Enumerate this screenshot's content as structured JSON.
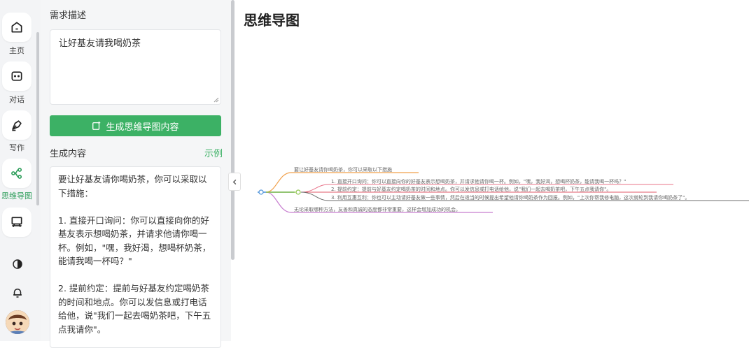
{
  "nav": {
    "items": [
      {
        "label": "主页",
        "icon": "home-icon"
      },
      {
        "label": "对话",
        "icon": "chat-icon"
      },
      {
        "label": "写作",
        "icon": "pen-icon"
      },
      {
        "label": "思维导图",
        "icon": "mindmap-icon",
        "active": true
      },
      {
        "label": "",
        "icon": "presentation-icon"
      }
    ],
    "bottom_icons": [
      "theme-contrast-icon",
      "bell-icon"
    ],
    "active_color": "#2e9e5b"
  },
  "form": {
    "requirement_label": "需求描述",
    "requirement_value": "让好基友请我喝奶茶",
    "generate_button": "生成思维导图内容",
    "result_label": "生成内容",
    "example_link": "示例",
    "result_paragraphs": [
      "要让好基友请你喝奶茶，你可以采取以下措施：",
      "1. 直接开口询问：你可以直接向你的好基友表示想喝奶茶，并请求他请你喝一杯。例如，\"嘿，我好渴，想喝杯奶茶，能请我喝一杯吗？\"",
      "2. 提前约定：提前与好基友约定喝奶茶的时间和地点。你可以发信息或打电话给他，说\"我们一起去喝奶茶吧，下午五点我请你\"。"
    ],
    "accent_color": "#3cb165"
  },
  "mindmap": {
    "title": "思维导图",
    "nodes": [
      {
        "text": "要让好基友请你喝奶茶，你可以采取以下措施",
        "color": "#f0a04b"
      },
      {
        "text": "1. 直接开口询问：你可以直接向你的好基友表示想喝奶茶，并请求他请你喝一杯。例如，\"嘿，我好渴，想喝杯奶茶，能请我喝一杯吗？\"",
        "color": "#e8748a"
      },
      {
        "text": "2. 提前约定：提前与好基友约定喝奶茶的时间和地点。你可以发信息或打电话给他，说\"我们一起去喝奶茶吧，下午五点我请你\"。",
        "color": "#e05a6a"
      },
      {
        "text": "3. 利用互惠互利：你也可以主动请好基友做一些事情，然后在适当的时候提出希望他请你喝奶茶作为回报。例如，\"上次你帮我修电脑，这次就轮到我请你喝奶茶了\"。",
        "color": "#6c6c6c"
      },
      {
        "text": "无论采取哪种方法，友善和真诚的态度都非常重要，这样会增加成功的机会。",
        "color": "#c77dcf"
      }
    ],
    "trunk_colors": [
      "#4a90d9",
      "#8bc34a"
    ]
  }
}
